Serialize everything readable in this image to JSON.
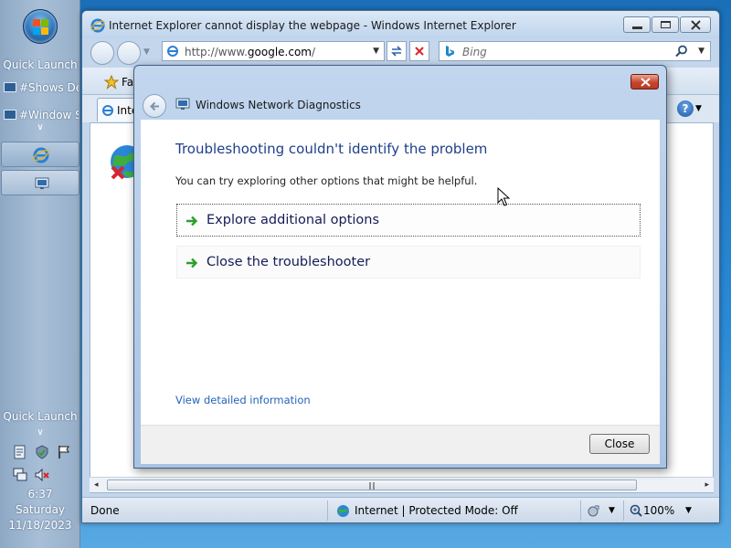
{
  "taskbar": {
    "quick_launch_label_top": "Quick Launch",
    "quick_launch_items": [
      "#Shows Desktop",
      "#Window Switcher"
    ],
    "quick_launch_label_bottom": "Quick Launch",
    "clock": {
      "time": "6:37",
      "day": "Saturday",
      "date": "11/18/2023"
    }
  },
  "browser": {
    "title": "Internet Explorer cannot display the webpage - Windows Internet Explorer",
    "address": {
      "prefix": "http://www.",
      "domain": "google.com",
      "suffix": "/"
    },
    "search_placeholder": "Bing",
    "favorites_label": "Fa",
    "tab_label": "Inte",
    "help_label": "?",
    "status": {
      "text": "Done",
      "zone": "Internet | Protected Mode: Off",
      "zoom": "100%"
    }
  },
  "dialog": {
    "title": "Windows Network Diagnostics",
    "heading": "Troubleshooting couldn't identify the problem",
    "subtext": "You can try exploring other options that might be helpful.",
    "options": [
      {
        "label": "Explore additional options"
      },
      {
        "label": "Close the troubleshooter"
      }
    ],
    "detail_link": "View detailed information",
    "close_button": "Close"
  },
  "colors": {
    "heading": "#1e3f8a",
    "command_link": "#151c55",
    "hyperlink": "#2463b8",
    "close_red": "#c8452d",
    "arrow_green": "#2ca02c",
    "error_red": "#d7262b"
  },
  "icons": {
    "start": "windows-flag-icon",
    "ie": "ie-logo-icon",
    "network_diag": "network-diagnostics-icon",
    "back": "back-arrow-icon",
    "arrow": "green-arrow-icon",
    "globe_error": "globe-error-icon",
    "search": "search-icon"
  }
}
